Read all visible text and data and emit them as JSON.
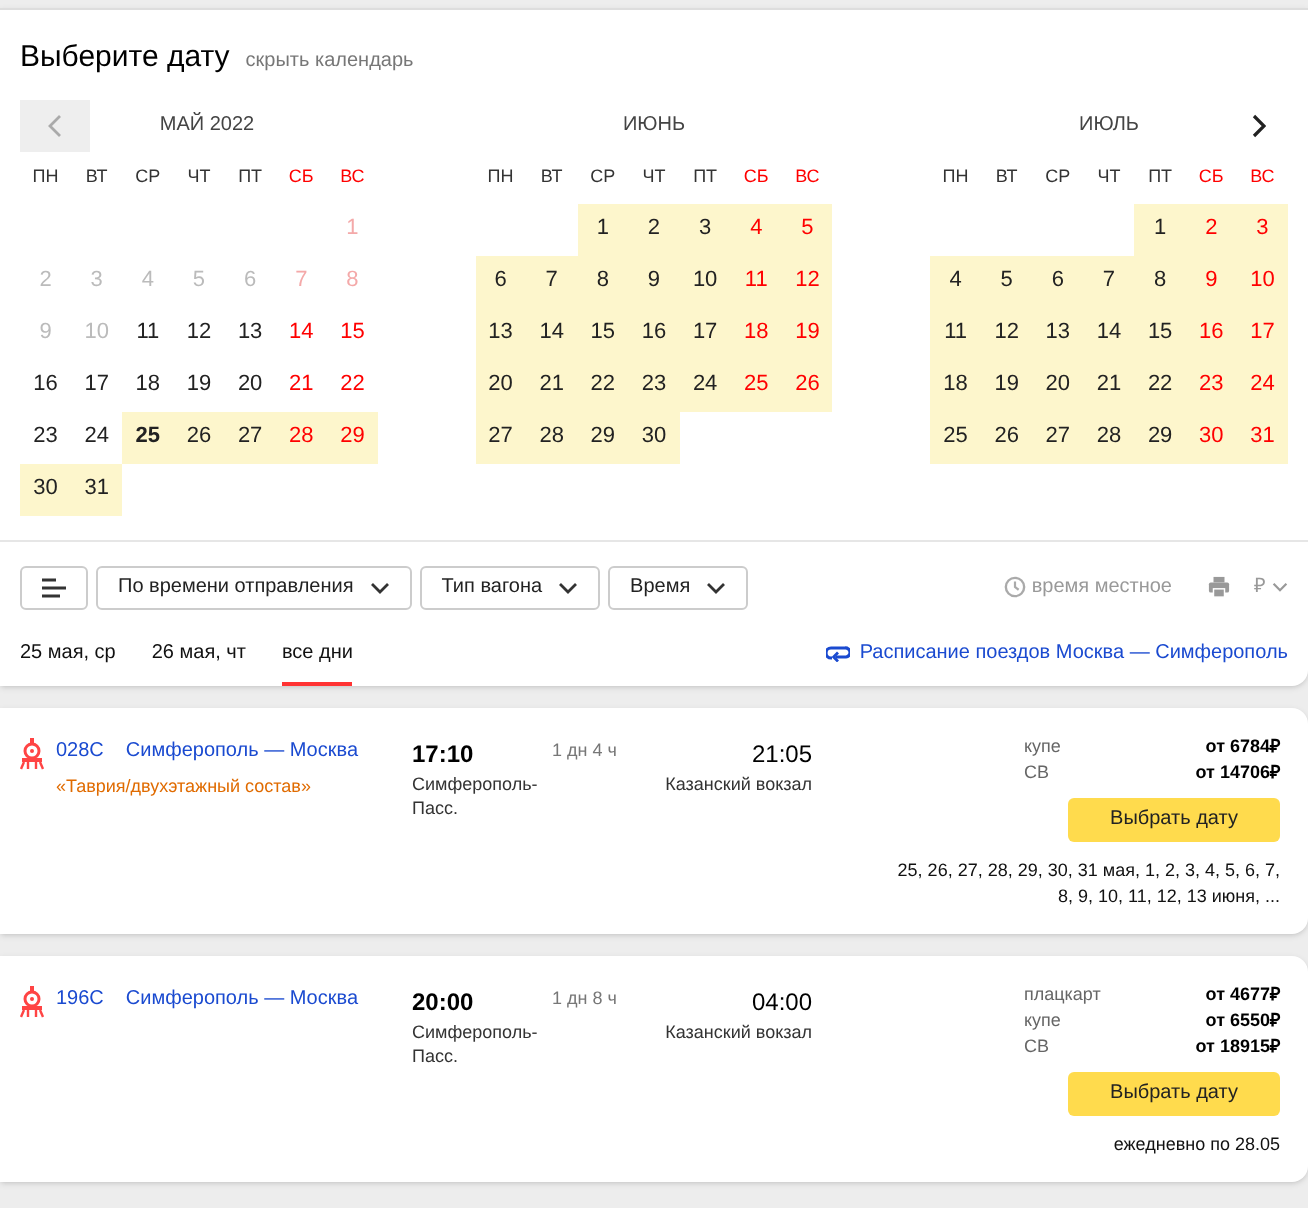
{
  "calendar": {
    "title": "Выберите дату",
    "hide_link": "скрыть календарь",
    "months": [
      {
        "title": "МАЙ 2022",
        "weekdays": [
          {
            "label": "ПН",
            "weekend": false
          },
          {
            "label": "ВТ",
            "weekend": false
          },
          {
            "label": "СР",
            "weekend": false
          },
          {
            "label": "ЧТ",
            "weekend": false
          },
          {
            "label": "ПТ",
            "weekend": false
          },
          {
            "label": "СБ",
            "weekend": true
          },
          {
            "label": "ВС",
            "weekend": true
          }
        ],
        "weeks": [
          [
            {
              "day": "1",
              "weekend": true,
              "past": true,
              "available": false,
              "today": false
            }
          ],
          [
            {
              "day": "2",
              "weekend": false,
              "past": true,
              "available": false,
              "today": false
            },
            {
              "day": "3",
              "weekend": false,
              "past": true,
              "available": false,
              "today": false
            },
            {
              "day": "4",
              "weekend": false,
              "past": true,
              "available": false,
              "today": false
            },
            {
              "day": "5",
              "weekend": false,
              "past": true,
              "available": false,
              "today": false
            },
            {
              "day": "6",
              "weekend": false,
              "past": true,
              "available": false,
              "today": false
            },
            {
              "day": "7",
              "weekend": true,
              "past": true,
              "available": false,
              "today": false
            },
            {
              "day": "8",
              "weekend": true,
              "past": true,
              "available": false,
              "today": false
            }
          ],
          [
            {
              "day": "9",
              "weekend": false,
              "past": true,
              "available": false,
              "today": false
            },
            {
              "day": "10",
              "weekend": false,
              "past": true,
              "available": false,
              "today": false
            },
            {
              "day": "11",
              "weekend": false,
              "past": false,
              "available": false,
              "today": false
            },
            {
              "day": "12",
              "weekend": false,
              "past": false,
              "available": false,
              "today": false
            },
            {
              "day": "13",
              "weekend": false,
              "past": false,
              "available": false,
              "today": false
            },
            {
              "day": "14",
              "weekend": true,
              "past": false,
              "available": false,
              "today": false
            },
            {
              "day": "15",
              "weekend": true,
              "past": false,
              "available": false,
              "today": false
            }
          ],
          [
            {
              "day": "16",
              "weekend": false,
              "past": false,
              "available": false,
              "today": false
            },
            {
              "day": "17",
              "weekend": false,
              "past": false,
              "available": false,
              "today": false
            },
            {
              "day": "18",
              "weekend": false,
              "past": false,
              "available": false,
              "today": false
            },
            {
              "day": "19",
              "weekend": false,
              "past": false,
              "available": false,
              "today": false
            },
            {
              "day": "20",
              "weekend": false,
              "past": false,
              "available": false,
              "today": false
            },
            {
              "day": "21",
              "weekend": true,
              "past": false,
              "available": false,
              "today": false
            },
            {
              "day": "22",
              "weekend": true,
              "past": false,
              "available": false,
              "today": false
            }
          ],
          [
            {
              "day": "23",
              "weekend": false,
              "past": false,
              "available": false,
              "today": false
            },
            {
              "day": "24",
              "weekend": false,
              "past": false,
              "available": false,
              "today": false
            },
            {
              "day": "25",
              "weekend": false,
              "past": false,
              "available": true,
              "today": true
            },
            {
              "day": "26",
              "weekend": false,
              "past": false,
              "available": true,
              "today": false
            },
            {
              "day": "27",
              "weekend": false,
              "past": false,
              "available": true,
              "today": false
            },
            {
              "day": "28",
              "weekend": true,
              "past": false,
              "available": true,
              "today": false
            },
            {
              "day": "29",
              "weekend": true,
              "past": false,
              "available": true,
              "today": false
            }
          ],
          [
            {
              "day": "30",
              "weekend": false,
              "past": false,
              "available": true,
              "today": false
            },
            {
              "day": "31",
              "weekend": false,
              "past": false,
              "available": true,
              "today": false
            }
          ]
        ]
      },
      {
        "title": "ИЮНЬ",
        "weekdays": [
          {
            "label": "ПН",
            "weekend": false
          },
          {
            "label": "ВТ",
            "weekend": false
          },
          {
            "label": "СР",
            "weekend": false
          },
          {
            "label": "ЧТ",
            "weekend": false
          },
          {
            "label": "ПТ",
            "weekend": false
          },
          {
            "label": "СБ",
            "weekend": true
          },
          {
            "label": "ВС",
            "weekend": true
          }
        ],
        "weeks": [
          [
            {
              "day": "1",
              "weekend": false,
              "past": false,
              "available": true,
              "today": false
            },
            {
              "day": "2",
              "weekend": false,
              "past": false,
              "available": true,
              "today": false
            },
            {
              "day": "3",
              "weekend": false,
              "past": false,
              "available": true,
              "today": false
            },
            {
              "day": "4",
              "weekend": true,
              "past": false,
              "available": true,
              "today": false
            },
            {
              "day": "5",
              "weekend": true,
              "past": false,
              "available": true,
              "today": false
            }
          ],
          [
            {
              "day": "6",
              "weekend": false,
              "past": false,
              "available": true,
              "today": false
            },
            {
              "day": "7",
              "weekend": false,
              "past": false,
              "available": true,
              "today": false
            },
            {
              "day": "8",
              "weekend": false,
              "past": false,
              "available": true,
              "today": false
            },
            {
              "day": "9",
              "weekend": false,
              "past": false,
              "available": true,
              "today": false
            },
            {
              "day": "10",
              "weekend": false,
              "past": false,
              "available": true,
              "today": false
            },
            {
              "day": "11",
              "weekend": true,
              "past": false,
              "available": true,
              "today": false
            },
            {
              "day": "12",
              "weekend": true,
              "past": false,
              "available": true,
              "today": false
            }
          ],
          [
            {
              "day": "13",
              "weekend": false,
              "past": false,
              "available": true,
              "today": false
            },
            {
              "day": "14",
              "weekend": false,
              "past": false,
              "available": true,
              "today": false
            },
            {
              "day": "15",
              "weekend": false,
              "past": false,
              "available": true,
              "today": false
            },
            {
              "day": "16",
              "weekend": false,
              "past": false,
              "available": true,
              "today": false
            },
            {
              "day": "17",
              "weekend": false,
              "past": false,
              "available": true,
              "today": false
            },
            {
              "day": "18",
              "weekend": true,
              "past": false,
              "available": true,
              "today": false
            },
            {
              "day": "19",
              "weekend": true,
              "past": false,
              "available": true,
              "today": false
            }
          ],
          [
            {
              "day": "20",
              "weekend": false,
              "past": false,
              "available": true,
              "today": false
            },
            {
              "day": "21",
              "weekend": false,
              "past": false,
              "available": true,
              "today": false
            },
            {
              "day": "22",
              "weekend": false,
              "past": false,
              "available": true,
              "today": false
            },
            {
              "day": "23",
              "weekend": false,
              "past": false,
              "available": true,
              "today": false
            },
            {
              "day": "24",
              "weekend": false,
              "past": false,
              "available": true,
              "today": false
            },
            {
              "day": "25",
              "weekend": true,
              "past": false,
              "available": true,
              "today": false
            },
            {
              "day": "26",
              "weekend": true,
              "past": false,
              "available": true,
              "today": false
            }
          ],
          [
            {
              "day": "27",
              "weekend": false,
              "past": false,
              "available": true,
              "today": false
            },
            {
              "day": "28",
              "weekend": false,
              "past": false,
              "available": true,
              "today": false
            },
            {
              "day": "29",
              "weekend": false,
              "past": false,
              "available": true,
              "today": false
            },
            {
              "day": "30",
              "weekend": false,
              "past": false,
              "available": true,
              "today": false
            }
          ]
        ]
      },
      {
        "title": "ИЮЛЬ",
        "weekdays": [
          {
            "label": "ПН",
            "weekend": false
          },
          {
            "label": "ВТ",
            "weekend": false
          },
          {
            "label": "СР",
            "weekend": false
          },
          {
            "label": "ЧТ",
            "weekend": false
          },
          {
            "label": "ПТ",
            "weekend": false
          },
          {
            "label": "СБ",
            "weekend": true
          },
          {
            "label": "ВС",
            "weekend": true
          }
        ],
        "weeks": [
          [
            {
              "day": "1",
              "weekend": false,
              "past": false,
              "available": true,
              "today": false
            },
            {
              "day": "2",
              "weekend": true,
              "past": false,
              "available": true,
              "today": false
            },
            {
              "day": "3",
              "weekend": true,
              "past": false,
              "available": true,
              "today": false
            }
          ],
          [
            {
              "day": "4",
              "weekend": false,
              "past": false,
              "available": true,
              "today": false
            },
            {
              "day": "5",
              "weekend": false,
              "past": false,
              "available": true,
              "today": false
            },
            {
              "day": "6",
              "weekend": false,
              "past": false,
              "available": true,
              "today": false
            },
            {
              "day": "7",
              "weekend": false,
              "past": false,
              "available": true,
              "today": false
            },
            {
              "day": "8",
              "weekend": false,
              "past": false,
              "available": true,
              "today": false
            },
            {
              "day": "9",
              "weekend": true,
              "past": false,
              "available": true,
              "today": false
            },
            {
              "day": "10",
              "weekend": true,
              "past": false,
              "available": true,
              "today": false
            }
          ],
          [
            {
              "day": "11",
              "weekend": false,
              "past": false,
              "available": true,
              "today": false
            },
            {
              "day": "12",
              "weekend": false,
              "past": false,
              "available": true,
              "today": false
            },
            {
              "day": "13",
              "weekend": false,
              "past": false,
              "available": true,
              "today": false
            },
            {
              "day": "14",
              "weekend": false,
              "past": false,
              "available": true,
              "today": false
            },
            {
              "day": "15",
              "weekend": false,
              "past": false,
              "available": true,
              "today": false
            },
            {
              "day": "16",
              "weekend": true,
              "past": false,
              "available": true,
              "today": false
            },
            {
              "day": "17",
              "weekend": true,
              "past": false,
              "available": true,
              "today": false
            }
          ],
          [
            {
              "day": "18",
              "weekend": false,
              "past": false,
              "available": true,
              "today": false
            },
            {
              "day": "19",
              "weekend": false,
              "past": false,
              "available": true,
              "today": false
            },
            {
              "day": "20",
              "weekend": false,
              "past": false,
              "available": true,
              "today": false
            },
            {
              "day": "21",
              "weekend": false,
              "past": false,
              "available": true,
              "today": false
            },
            {
              "day": "22",
              "weekend": false,
              "past": false,
              "available": true,
              "today": false
            },
            {
              "day": "23",
              "weekend": true,
              "past": false,
              "available": true,
              "today": false
            },
            {
              "day": "24",
              "weekend": true,
              "past": false,
              "available": true,
              "today": false
            }
          ],
          [
            {
              "day": "25",
              "weekend": false,
              "past": false,
              "available": true,
              "today": false
            },
            {
              "day": "26",
              "weekend": false,
              "past": false,
              "available": true,
              "today": false
            },
            {
              "day": "27",
              "weekend": false,
              "past": false,
              "available": true,
              "today": false
            },
            {
              "day": "28",
              "weekend": false,
              "past": false,
              "available": true,
              "today": false
            },
            {
              "day": "29",
              "weekend": false,
              "past": false,
              "available": true,
              "today": false
            },
            {
              "day": "30",
              "weekend": true,
              "past": false,
              "available": true,
              "today": false
            },
            {
              "day": "31",
              "weekend": true,
              "past": false,
              "available": true,
              "today": false
            }
          ]
        ]
      }
    ]
  },
  "toolbar": {
    "sort": "По времени отправления",
    "filters": [
      "Тип вагона",
      "Время"
    ],
    "local_time": "время местное",
    "currency": "₽"
  },
  "day_tabs": [
    {
      "label": "25 мая, ср",
      "selected": false
    },
    {
      "label": "26 мая, чт",
      "selected": false
    },
    {
      "label": "все дни",
      "selected": true
    }
  ],
  "schedule_link": "Расписание поездов Москва — Симферополь",
  "trains": [
    {
      "number": "028С",
      "route": "Симферополь — Москва",
      "brand": "«Таврия/двухэтажный состав»",
      "departure_time": "17:10",
      "departure_station": "Симферополь-Пасс.",
      "duration": "1 дн 4 ч",
      "arrival_time": "21:05",
      "arrival_station": "Казанский вокзал",
      "prices": [
        {
          "class": "купе",
          "price": "от 6784₽"
        },
        {
          "class": "СВ",
          "price": "от 14706₽"
        }
      ],
      "button": "Выбрать дату",
      "dates": "25, 26, 27, 28, 29, 30, 31 мая, 1, 2, 3, 4, 5, 6, 7, 8, 9, 10, 11, 12, 13 июня, ..."
    },
    {
      "number": "196С",
      "route": "Симферополь — Москва",
      "departure_time": "20:00",
      "departure_station": "Симферополь-Пасс.",
      "duration": "1 дн 8 ч",
      "arrival_time": "04:00",
      "arrival_station": "Казанский вокзал",
      "prices": [
        {
          "class": "плацкарт",
          "price": "от 4677₽"
        },
        {
          "class": "купе",
          "price": "от 6550₽"
        },
        {
          "class": "СВ",
          "price": "от 18915₽"
        }
      ],
      "button": "Выбрать дату",
      "dates": "ежедневно по 28.05"
    }
  ]
}
